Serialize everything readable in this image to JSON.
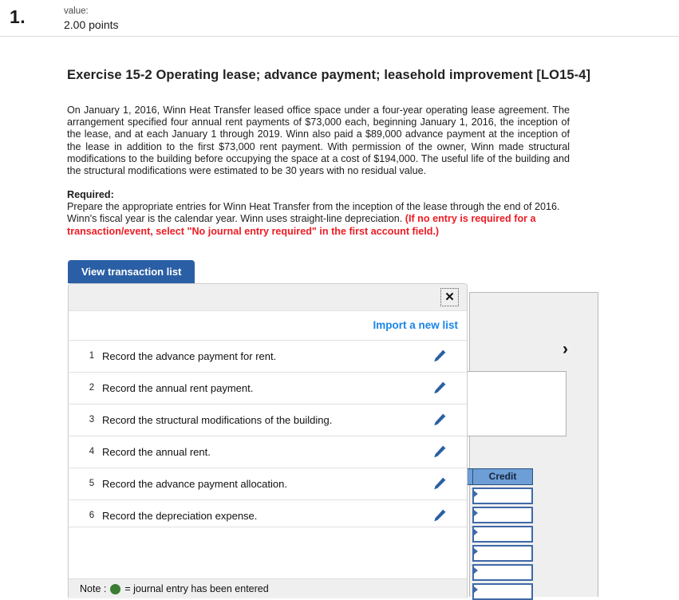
{
  "header": {
    "question_number": "1.",
    "value_label": "value:",
    "points": "2.00 points"
  },
  "exercise": {
    "title": "Exercise 15-2 Operating lease; advance payment; leasehold improvement [LO15-4]",
    "scenario": "On January 1, 2016, Winn Heat Transfer leased office space under a four-year operating lease agreement. The arrangement specified four annual rent payments of $73,000 each, beginning January 1, 2016, the inception of the lease, and at each January 1 through 2019. Winn also paid a $89,000 advance payment at the inception of the lease in addition to the first $73,000 rent payment. With permission of the owner, Winn made structural modifications to the building before occupying the space at a cost of $194,000. The useful life of the building and the structural modifications were estimated to be 30 years with no residual value.",
    "required_label": "Required:",
    "required_text": "Prepare the appropriate entries for Winn Heat Transfer from the inception of the lease through the end of 2016. Winn's fiscal year is the calendar year. Winn uses straight-line depreciation. ",
    "required_red": "(If no entry is required for a transaction/event, select \"No journal entry required\" in the first account field.)"
  },
  "tab": {
    "view_transaction_list": "View transaction list"
  },
  "overlay": {
    "close_label": "✕",
    "import_link": "Import a new list",
    "note_prefix": "Note :",
    "note_text": "= journal entry has been entered",
    "transactions": [
      {
        "index": "1",
        "text": "Record the advance payment for rent."
      },
      {
        "index": "2",
        "text": "Record the annual rent payment."
      },
      {
        "index": "3",
        "text": "Record the structural modifications of the building."
      },
      {
        "index": "4",
        "text": "Record the annual rent."
      },
      {
        "index": "5",
        "text": "Record the advance payment allocation."
      },
      {
        "index": "6",
        "text": "Record the depreciation expense."
      }
    ]
  },
  "journal": {
    "credit_header": "Credit",
    "next_chevron": "›",
    "credit_rows": [
      "",
      "",
      "",
      "",
      "",
      ""
    ]
  },
  "colors": {
    "tab_blue": "#2a5fa5",
    "link_blue": "#1a84e8",
    "red_note": "#ed1c24",
    "credit_header_blue": "#6d9ed6",
    "green_dot": "#3a7d33"
  }
}
